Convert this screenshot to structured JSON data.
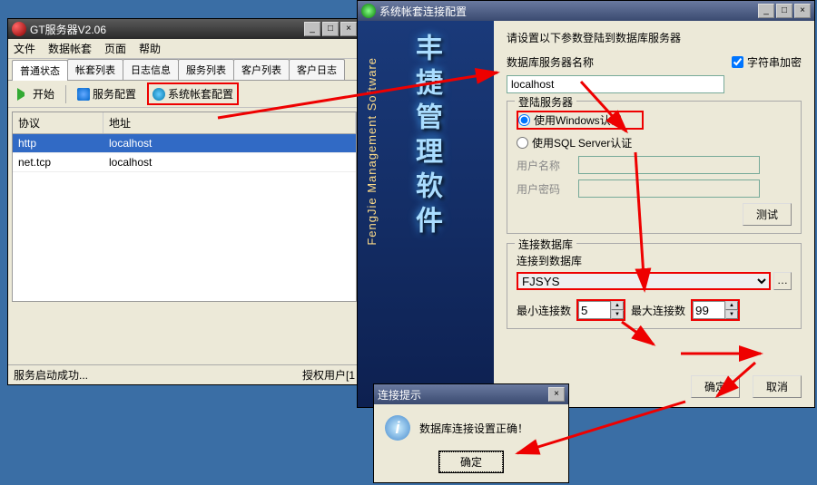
{
  "main": {
    "title": "GT服务器V2.06",
    "menu": {
      "file": "文件",
      "accounts": "数据帐套",
      "page": "页面",
      "help": "帮助"
    },
    "tabs": [
      "普通状态",
      "帐套列表",
      "日志信息",
      "服务列表",
      "客户列表",
      "客户日志"
    ],
    "toolbar": {
      "start": "开始",
      "srvcfg": "服务配置",
      "syscfg": "系统帐套配置"
    },
    "table": {
      "cols": [
        "协议",
        "地址"
      ],
      "rows": [
        {
          "proto": "http",
          "addr": "localhost"
        },
        {
          "proto": "net.tcp",
          "addr": "localhost"
        }
      ]
    },
    "status_left": "服务启动成功...",
    "status_right": "授权用户[1"
  },
  "cfg": {
    "title": "系统帐套连接配置",
    "side_cn": "丰捷管理软件",
    "side_en": "FengJie Management Software",
    "hint": "请设置以下参数登陆到数据库服务器",
    "server_label": "数据库服务器名称",
    "server_value": "localhost",
    "encrypt_label": "字符串加密",
    "login_title": "登陆服务器",
    "auth_win": "使用Windows认证",
    "auth_sql": "使用SQL Server认证",
    "user_label": "用户名称",
    "pwd_label": "用户密码",
    "test_btn": "测试",
    "db_title": "连接数据库",
    "db_label": "连接到数据库",
    "db_value": "FJSYS",
    "min_label": "最小连接数",
    "min_value": "5",
    "max_label": "最大连接数",
    "max_value": "99",
    "ok": "确定",
    "cancel": "取消"
  },
  "msg": {
    "title": "连接提示",
    "text": "数据库连接设置正确！",
    "ok": "确定"
  }
}
